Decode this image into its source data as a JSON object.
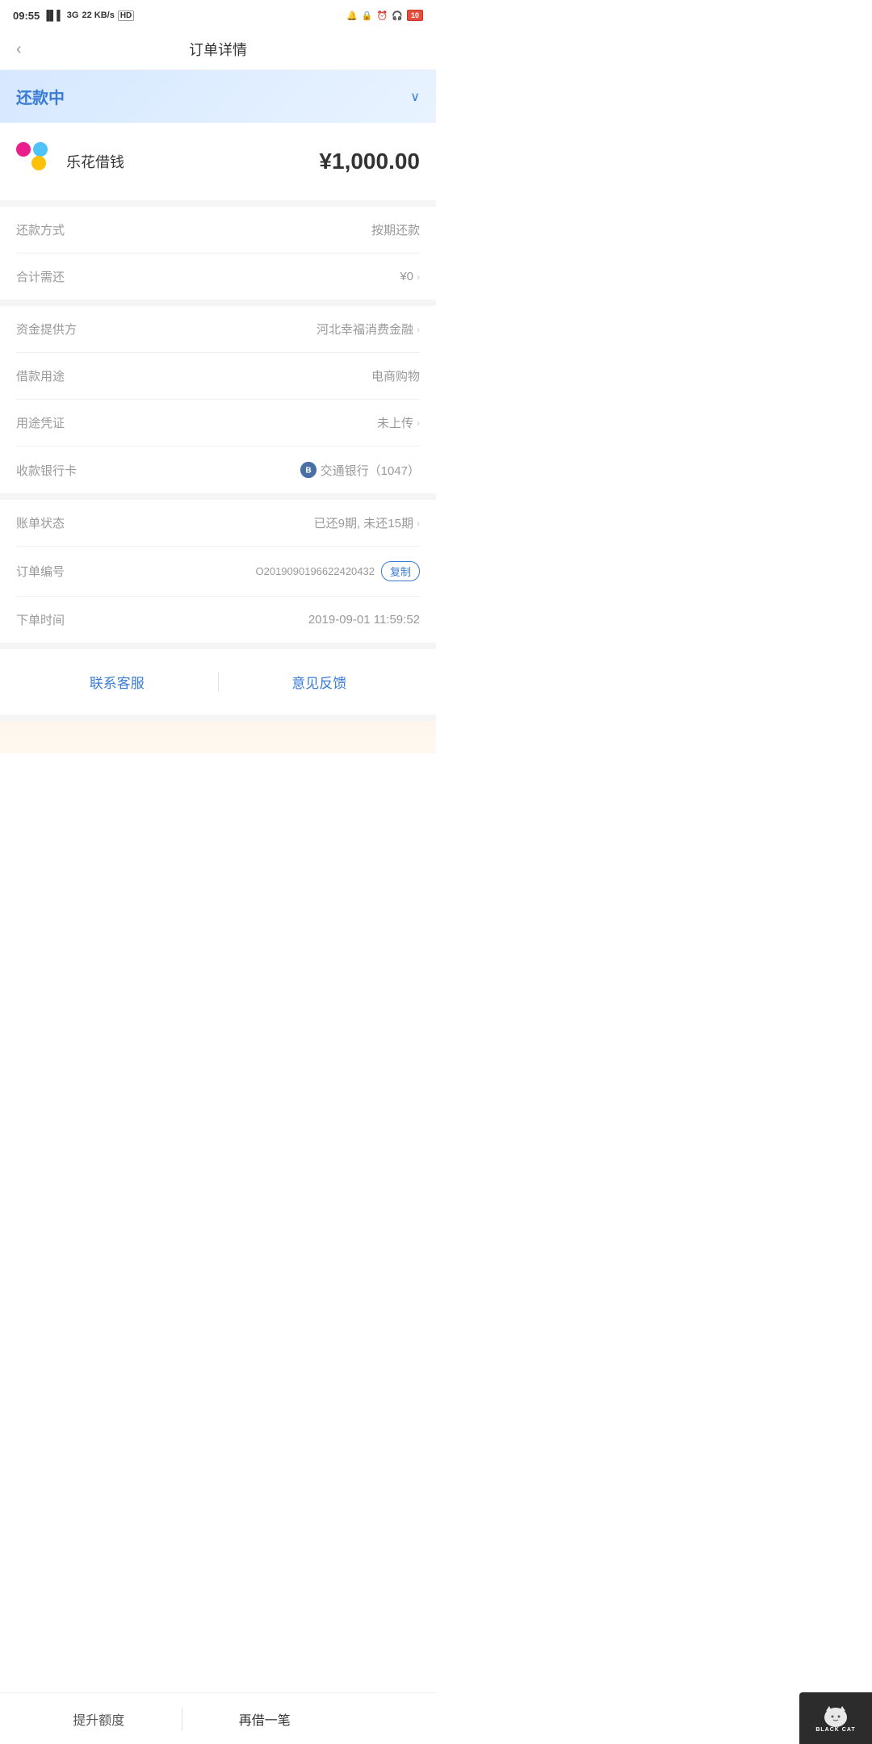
{
  "statusBar": {
    "time": "09:55",
    "signal": "4G 3G",
    "speed": "22 KB/s",
    "battery": "10"
  },
  "header": {
    "back": "‹",
    "title": "订单详情"
  },
  "statusBanner": {
    "text": "还款中",
    "chevron": "∨"
  },
  "loanCard": {
    "name": "乐花借钱",
    "amount": "¥1,000.00"
  },
  "repaymentInfo": {
    "rows": [
      {
        "label": "还款方式",
        "value": "按期还款",
        "clickable": false
      },
      {
        "label": "合计需还",
        "value": "¥0",
        "clickable": true
      }
    ]
  },
  "fundInfo": {
    "rows": [
      {
        "label": "资金提供方",
        "value": "河北幸福消费金融",
        "clickable": true
      },
      {
        "label": "借款用途",
        "value": "电商购物",
        "clickable": false
      },
      {
        "label": "用途凭证",
        "value": "未上传",
        "clickable": true
      },
      {
        "label": "收款银行卡",
        "value": "交通银行（1047）",
        "clickable": false,
        "hasIcon": true
      }
    ]
  },
  "orderInfo": {
    "rows": [
      {
        "label": "账单状态",
        "value": "已还9期, 未还15期",
        "clickable": true
      },
      {
        "label": "订单编号",
        "value": "O2019090196622420432",
        "copy": true
      },
      {
        "label": "下单时间",
        "value": "2019-09-01 11:59:52",
        "clickable": false
      }
    ]
  },
  "actions": {
    "contact": "联系客服",
    "feedback": "意见反馈"
  },
  "bottomBar": {
    "upgrade": "提升额度",
    "borrow": "再借一笔"
  },
  "watermark": {
    "cat": "🐱",
    "text": "BLACK CAT"
  }
}
